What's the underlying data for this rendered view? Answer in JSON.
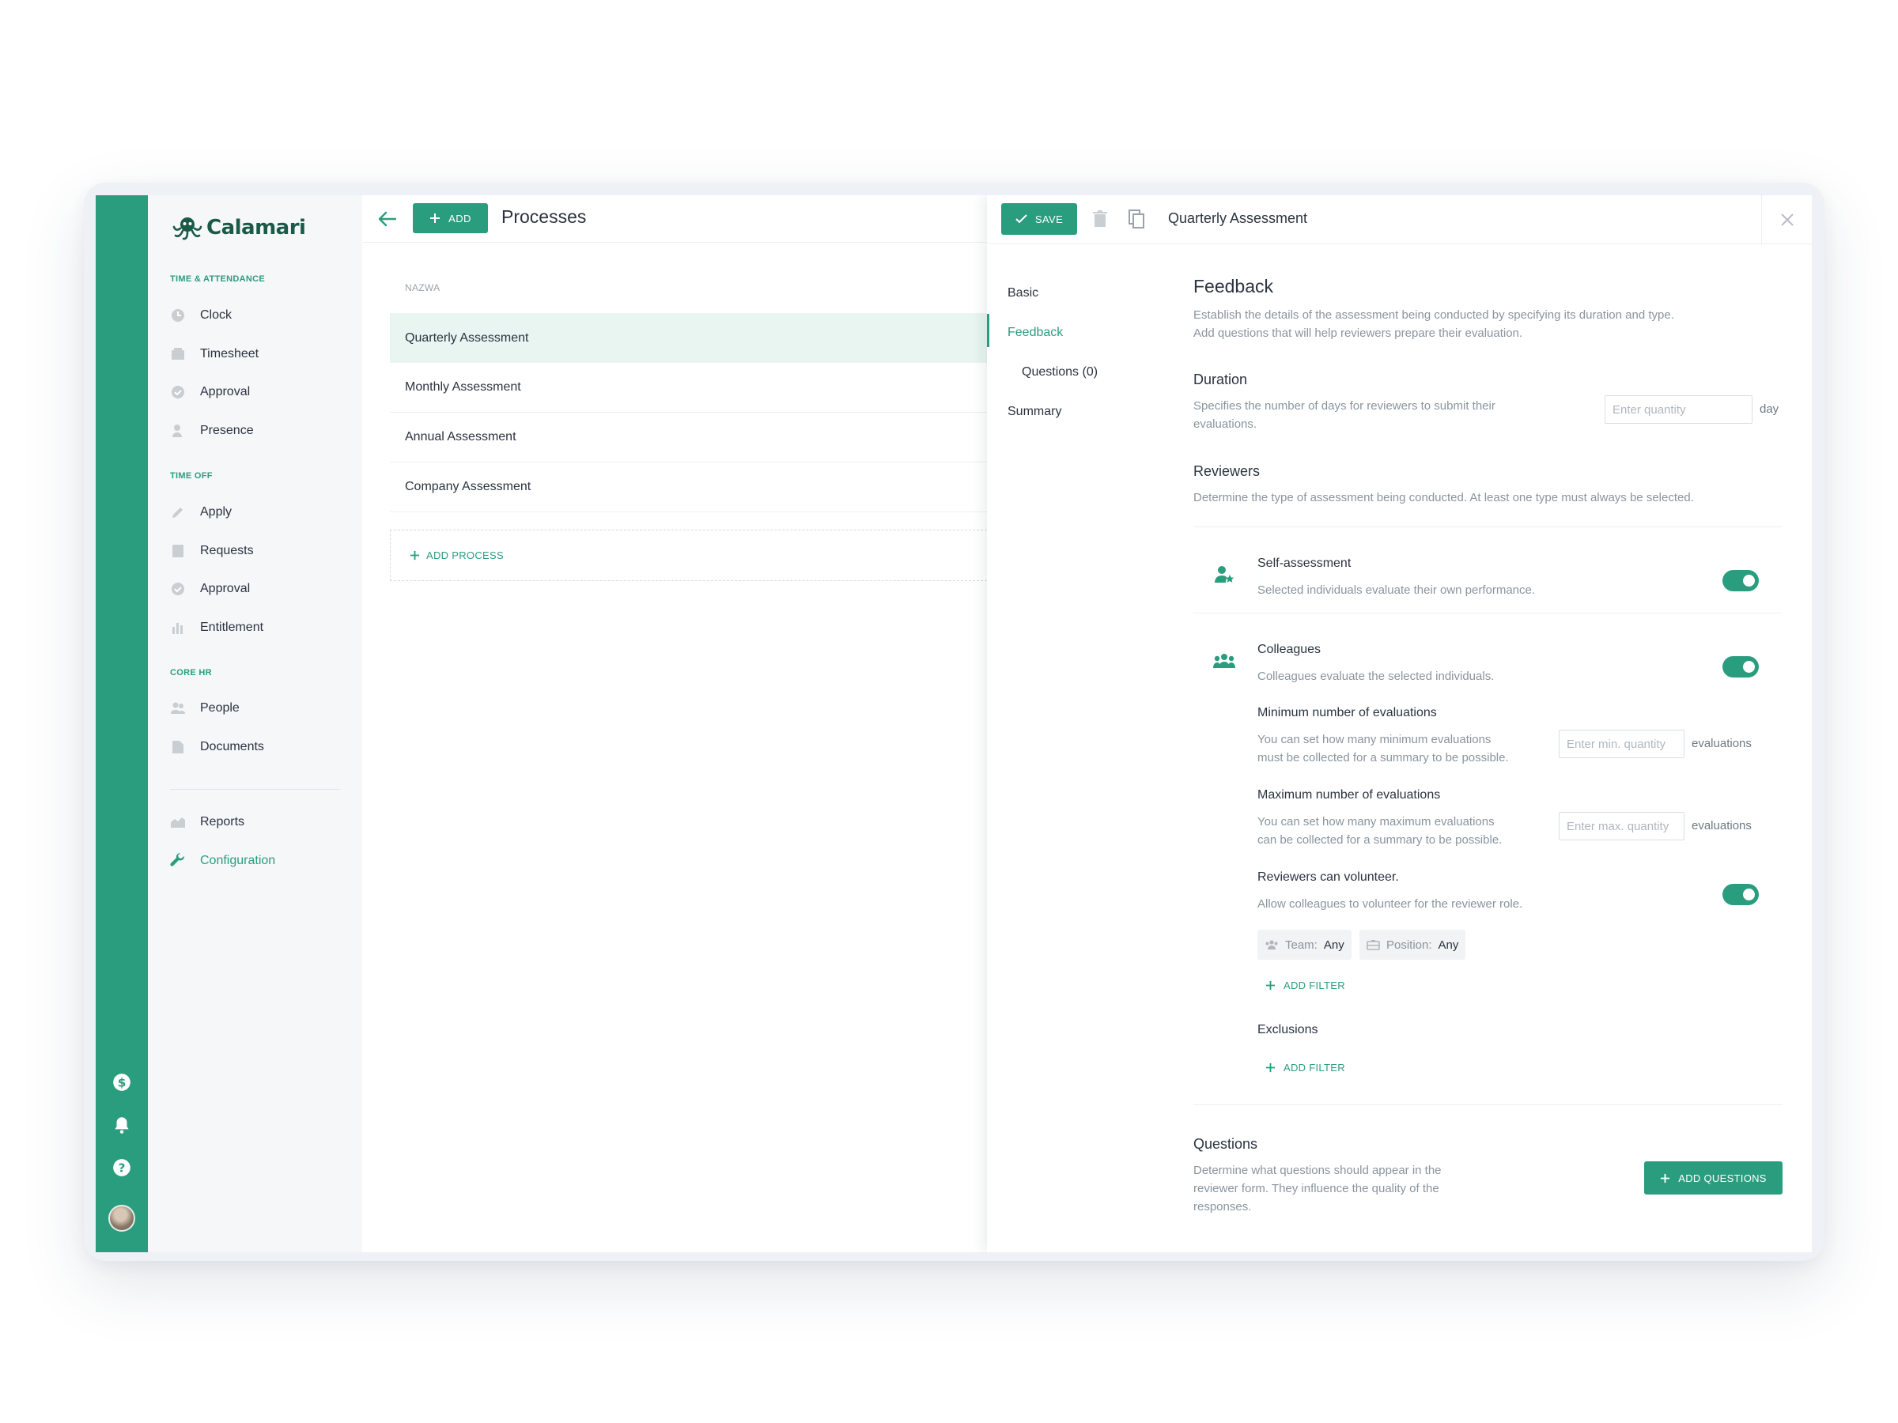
{
  "brand": {
    "name": "Calamari"
  },
  "colors": {
    "accent": "#2a9d7f",
    "rail": "#2a9d7f",
    "text": "#2b3340",
    "muted": "#8a949e"
  },
  "sidebar": {
    "sections": [
      {
        "label": "TIME & ATTENDANCE",
        "items": [
          {
            "label": "Clock",
            "icon": "clock-icon"
          },
          {
            "label": "Timesheet",
            "icon": "timesheet-icon"
          },
          {
            "label": "Approval",
            "icon": "check-circle-icon"
          },
          {
            "label": "Presence",
            "icon": "presence-icon"
          }
        ]
      },
      {
        "label": "TIME OFF",
        "items": [
          {
            "label": "Apply",
            "icon": "pencil-icon"
          },
          {
            "label": "Requests",
            "icon": "document-icon"
          },
          {
            "label": "Approval",
            "icon": "check-circle-icon"
          },
          {
            "label": "Entitlement",
            "icon": "bar-chart-icon"
          }
        ]
      },
      {
        "label": "CORE HR",
        "items": [
          {
            "label": "People",
            "icon": "people-icon"
          },
          {
            "label": "Documents",
            "icon": "file-icon"
          }
        ]
      }
    ],
    "bottom": [
      {
        "label": "Reports",
        "icon": "reports-icon"
      },
      {
        "label": "Configuration",
        "icon": "wrench-icon",
        "active": true
      }
    ]
  },
  "processes": {
    "add_label": "ADD",
    "title": "Processes",
    "column_header": "NAZWA",
    "rows": [
      {
        "name": "Quarterly Assessment",
        "selected": true
      },
      {
        "name": "Monthly Assessment"
      },
      {
        "name": "Annual Assessment"
      },
      {
        "name": "Company Assessment"
      }
    ],
    "add_process_label": "ADD PROCESS"
  },
  "detail": {
    "save_label": "SAVE",
    "title": "Quarterly Assessment",
    "subnav": [
      {
        "label": "Basic"
      },
      {
        "label": "Feedback",
        "active": true
      },
      {
        "label": "Questions (0)"
      },
      {
        "label": "Summary"
      }
    ],
    "feedback": {
      "title": "Feedback",
      "description_1": "Establish the details of the assessment being conducted by specifying its duration and type.",
      "description_2": "Add questions that will help reviewers prepare their evaluation."
    },
    "duration": {
      "title": "Duration",
      "description_1": "Specifies the number of days for reviewers to submit their",
      "description_2": "evaluations.",
      "placeholder": "Enter quantity",
      "unit": "day"
    },
    "reviewers": {
      "title": "Reviewers",
      "description": "Determine the type of assessment being conducted. At least one type must always be selected.",
      "self": {
        "title": "Self-assessment",
        "description": "Selected individuals evaluate their own performance.",
        "enabled": true
      },
      "colleagues": {
        "title": "Colleagues",
        "description": "Colleagues evaluate the selected individuals.",
        "enabled": true
      },
      "min": {
        "title": "Minimum number of evaluations",
        "description_1": "You can set how many minimum evaluations",
        "description_2": "must be collected for a summary to be possible.",
        "placeholder": "Enter min. quantity",
        "unit": "evaluations"
      },
      "max": {
        "title": "Maximum number of evaluations",
        "description_1": "You can set how many maximum evaluations",
        "description_2": "can be collected for a summary to be possible.",
        "placeholder": "Enter max. quantity",
        "unit": "evaluations"
      },
      "volunteer": {
        "title": "Reviewers can volunteer.",
        "description": "Allow colleagues to volunteer for the reviewer role.",
        "enabled": true
      },
      "filters": [
        {
          "key": "Team:",
          "value": "Any",
          "icon": "team-icon"
        },
        {
          "key": "Position:",
          "value": "Any",
          "icon": "briefcase-icon"
        }
      ],
      "add_filter_label": "ADD FILTER",
      "exclusions_title": "Exclusions",
      "exclusions_add_filter_label": "ADD FILTER"
    },
    "questions": {
      "title": "Questions",
      "description_1": "Determine what questions should appear in the",
      "description_2": "reviewer form. They influence the quality of the",
      "description_3": "responses.",
      "button_label": "ADD QUESTIONS"
    }
  }
}
